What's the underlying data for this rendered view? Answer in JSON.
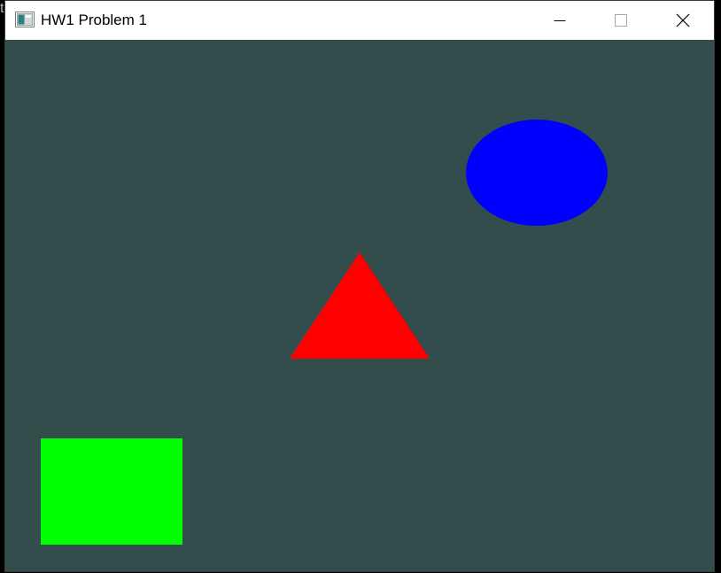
{
  "window": {
    "title": "HW1 Problem 1"
  },
  "title_controls": {
    "minimize_icon": "minimize-icon",
    "maximize_icon": "maximize-icon",
    "close_icon": "close-icon"
  },
  "colors": {
    "canvas_background": "#334d4d",
    "ellipse": "#0000ff",
    "triangle": "#ff0000",
    "rectangle": "#00ff00",
    "titlebar": "#ffffff"
  },
  "shapes": [
    {
      "kind": "ellipse",
      "color": "#0000ff"
    },
    {
      "kind": "triangle",
      "color": "#ff0000"
    },
    {
      "kind": "rectangle",
      "color": "#00ff00"
    }
  ]
}
